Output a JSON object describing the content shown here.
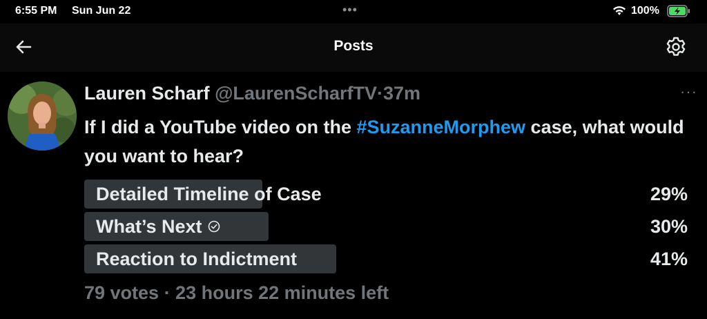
{
  "status_bar": {
    "time": "6:55 PM",
    "date": "Sun Jun 22",
    "battery": "100%",
    "icons": [
      "wifi-icon",
      "battery-charging-icon"
    ]
  },
  "nav": {
    "title": "Posts",
    "back_icon": "arrow-left-icon",
    "settings_icon": "gear-icon"
  },
  "post": {
    "author_name": "Lauren Scharf",
    "author_handle": "@LaurenScharfTV",
    "separator": "·",
    "time": "37m",
    "text_before": "If I did a YouTube video on the ",
    "hashtag": "#SuzanneMorphew",
    "text_after": " case, what would you want to hear?",
    "more_icon": "more-horizontal-icon"
  },
  "poll": {
    "options": [
      {
        "label": "Detailed Timeline of Case",
        "percent_text": "29%",
        "percent": 29,
        "selected": false
      },
      {
        "label": "What’s Next",
        "percent_text": "30%",
        "percent": 30,
        "selected": true
      },
      {
        "label": "Reaction to Indictment",
        "percent_text": "41%",
        "percent": 41,
        "selected": false
      }
    ],
    "footer": "79 votes · 23 hours 22 minutes left"
  },
  "colors": {
    "background": "#000000",
    "text": "#e7e9ea",
    "muted": "#71767b",
    "hashtag": "#1d9bf0",
    "poll_bar": "#333639",
    "battery": "#4cd964"
  }
}
